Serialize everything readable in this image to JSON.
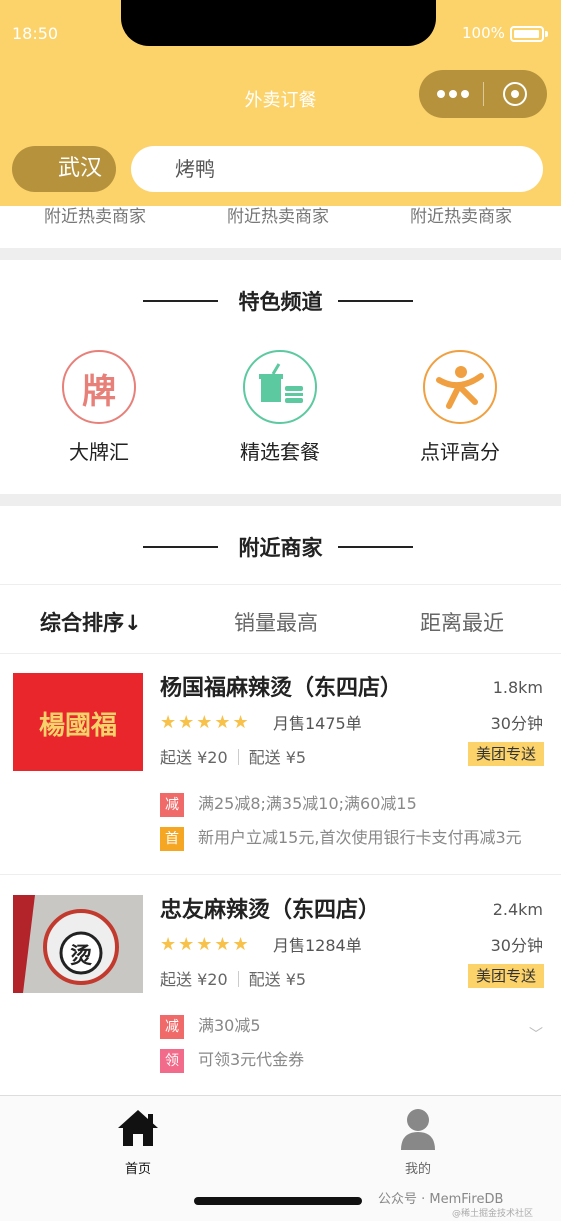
{
  "status": {
    "time": "18:50",
    "battery": "100%"
  },
  "nav": {
    "title": "外卖订餐"
  },
  "location": {
    "city": "武汉"
  },
  "search": {
    "query": "烤鸭"
  },
  "hot_strip": [
    "附近热卖商家",
    "附近热卖商家",
    "附近热卖商家"
  ],
  "channels": {
    "title": "特色频道",
    "items": [
      {
        "label": "大牌汇",
        "glyph": "牌",
        "icon": "brand-icon",
        "color": "#e8807a"
      },
      {
        "label": "精选套餐",
        "icon": "meal-set-icon",
        "color": "#5cc9a0"
      },
      {
        "label": "点评高分",
        "icon": "high-score-icon",
        "color": "#f0a040"
      }
    ]
  },
  "nearby": {
    "title": "附近商家"
  },
  "sort": {
    "items": [
      "综合排序↓",
      "销量最高",
      "距离最近"
    ]
  },
  "shops": [
    {
      "name": "杨国福麻辣烫（东四店）",
      "logo_text": "楊國福",
      "distance": "1.8km",
      "rating": 4.5,
      "stars": "★★★★★",
      "sales": "月售1475单",
      "time": "30分钟",
      "min_order": "起送 ¥20",
      "delivery_fee": "配送 ¥5",
      "badge": "美团专送",
      "promos": [
        {
          "tag": "减",
          "color": "#f06a6a",
          "text": "满25减8;满35减10;满60减15"
        },
        {
          "tag": "首",
          "color": "#f5a623",
          "text": "新用户立减15元,首次使用银行卡支付再减3元"
        }
      ]
    },
    {
      "name": "忠友麻辣烫（东四店）",
      "logo_text": "烫",
      "distance": "2.4km",
      "rating": 5,
      "stars": "★★★★★",
      "sales": "月售1284单",
      "time": "30分钟",
      "min_order": "起送 ¥20",
      "delivery_fee": "配送 ¥5",
      "badge": "美团专送",
      "promos": [
        {
          "tag": "减",
          "color": "#f06a6a",
          "text": "满30减5"
        },
        {
          "tag": "领",
          "color": "#f26b8a",
          "text": "可领3元代金券"
        }
      ]
    }
  ],
  "tabbar": {
    "items": [
      {
        "label": "首页",
        "icon": "home-icon",
        "active": true
      },
      {
        "label": "我的",
        "icon": "user-icon",
        "active": false
      }
    ]
  },
  "watermark": {
    "text": "公众号 · MemFireDB",
    "sub": "@稀土掘金技术社区"
  }
}
